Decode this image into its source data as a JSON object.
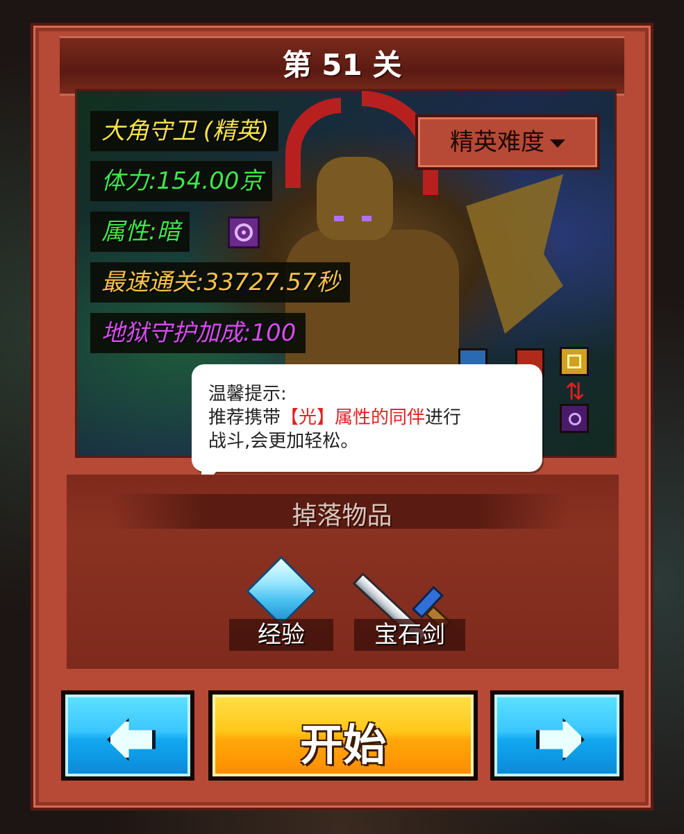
{
  "stage": {
    "title": "第 51 关"
  },
  "boss": {
    "name": "大角守卫 (精英)",
    "hp": "体力:154.00京",
    "attribute": "属性:暗",
    "best_time": "最速通关:33727.57秒",
    "bonus": "地狱守护加成:100"
  },
  "difficulty": {
    "label": "精英难度"
  },
  "tip": {
    "heading": "温馨提示:",
    "line1_prefix": "推荐携带",
    "line1_highlight": "【光】属性的同伴",
    "line1_suffix": "进行",
    "line2": "战斗,会更加轻松。"
  },
  "drops": {
    "title": "掉落物品",
    "items": [
      {
        "label": "经验",
        "icon": "crystal-icon"
      },
      {
        "label": "宝石剑",
        "icon": "sword-icon"
      }
    ]
  },
  "buttons": {
    "start": "开始",
    "prev_icon": "arrow-left-icon",
    "next_icon": "arrow-right-icon"
  },
  "colors": {
    "accent_red": "#e02020",
    "panel": "#b64a36",
    "start_gold": "#ffc81a",
    "nav_blue": "#3ac6ff"
  }
}
